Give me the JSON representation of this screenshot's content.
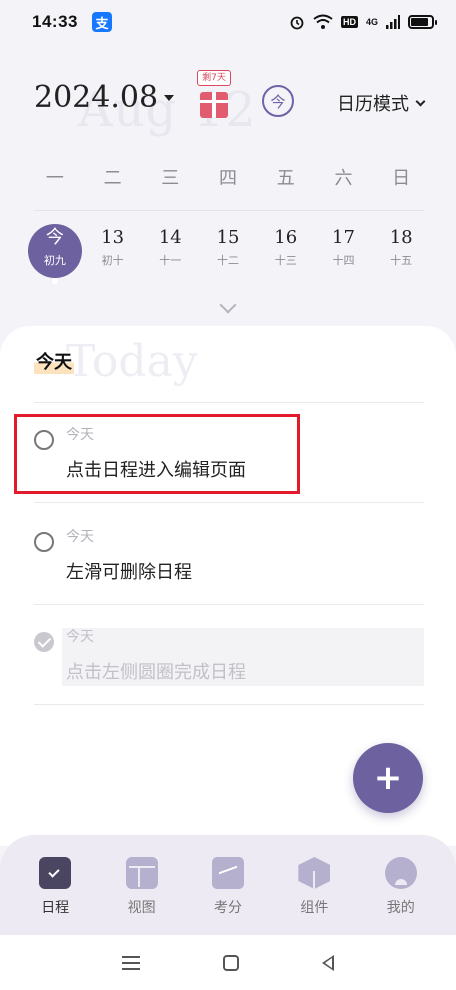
{
  "status_bar": {
    "time": "14:33",
    "alipay_badge": "支",
    "hd_label": "HD",
    "network_label": "4G",
    "battery_level": 0.85
  },
  "header": {
    "month": "2024.08",
    "watermark": "Aug 12",
    "gift_tag": "剩7天",
    "today_button": "今",
    "mode_select": "日历模式"
  },
  "weekdays": [
    "一",
    "二",
    "三",
    "四",
    "五",
    "六",
    "日"
  ],
  "dates": [
    {
      "day": "今",
      "lunar": "初九",
      "selected": true
    },
    {
      "day": "13",
      "lunar": "初十"
    },
    {
      "day": "14",
      "lunar": "十一"
    },
    {
      "day": "15",
      "lunar": "十二"
    },
    {
      "day": "16",
      "lunar": "十三"
    },
    {
      "day": "17",
      "lunar": "十四"
    },
    {
      "day": "18",
      "lunar": "十五"
    }
  ],
  "section": {
    "title": "今天",
    "watermark": "Today"
  },
  "todos": [
    {
      "date": "今天",
      "title": "点击日程进入编辑页面",
      "done": false
    },
    {
      "date": "今天",
      "title": "左滑可删除日程",
      "done": false
    },
    {
      "date": "今天",
      "title": "点击左侧圆圈完成日程",
      "done": true
    }
  ],
  "fab": {
    "label": "+"
  },
  "tabs": [
    {
      "label": "日程",
      "icon": "calendar-icon",
      "active": true
    },
    {
      "label": "视图",
      "icon": "view-icon"
    },
    {
      "label": "考分",
      "icon": "score-icon"
    },
    {
      "label": "组件",
      "icon": "widget-icon"
    },
    {
      "label": "我的",
      "icon": "profile-icon"
    }
  ],
  "colors": {
    "accent": "#6d619f",
    "highlight": "#e3192c",
    "gift": "#e05c6e"
  }
}
